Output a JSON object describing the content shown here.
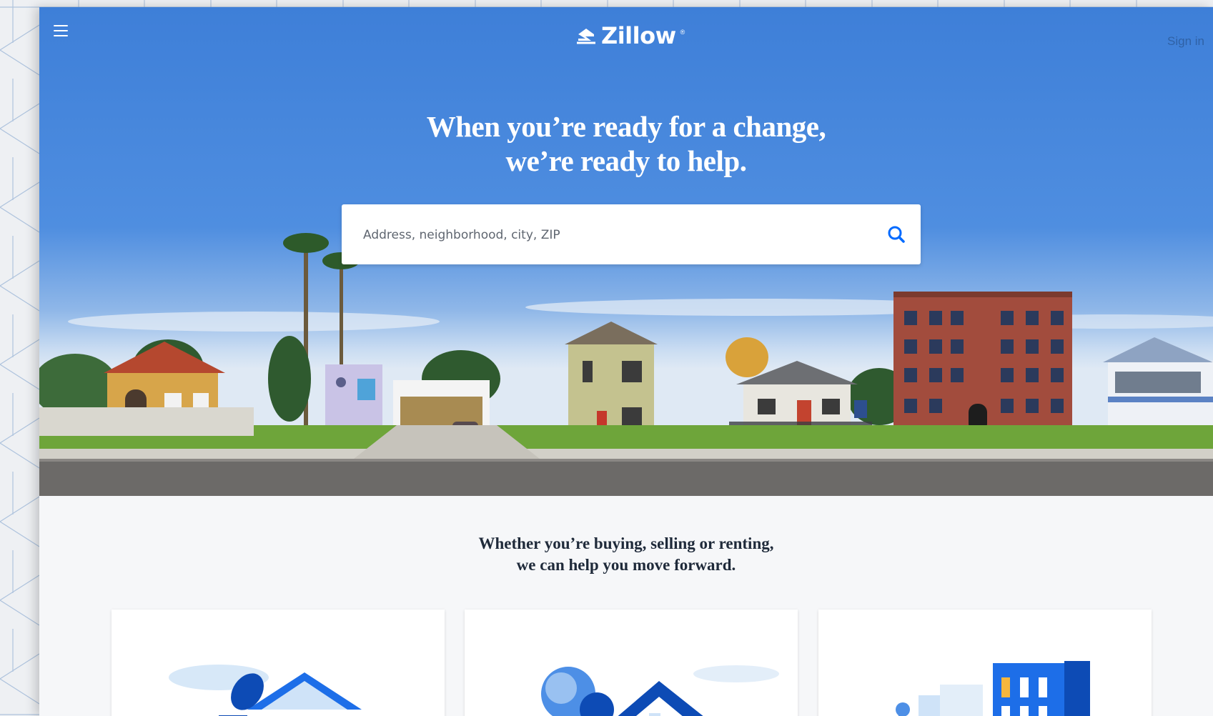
{
  "header": {
    "logo_text": "Zillow",
    "logo_mark": "®",
    "sign_in_label": "Sign in",
    "menu_icon": "hamburger-menu-icon"
  },
  "hero": {
    "headline_line1": "When you’re ready for a change,",
    "headline_line2": "we’re ready to help."
  },
  "search": {
    "placeholder": "Address, neighborhood, city, ZIP",
    "value": "",
    "icon": "search-icon"
  },
  "intro": {
    "line1": "Whether you’re buying, selling or renting,",
    "line2": "we can help you move forward."
  },
  "cards": [
    {
      "icon": "buy-house-illustration-icon"
    },
    {
      "icon": "sell-house-illustration-icon"
    },
    {
      "icon": "rent-building-illustration-icon"
    }
  ],
  "colors": {
    "brand_blue": "#3e7fd8",
    "accent_blue": "#006aff",
    "dark_blue": "#0d4bb5",
    "text_dark": "#1f2a3a"
  }
}
